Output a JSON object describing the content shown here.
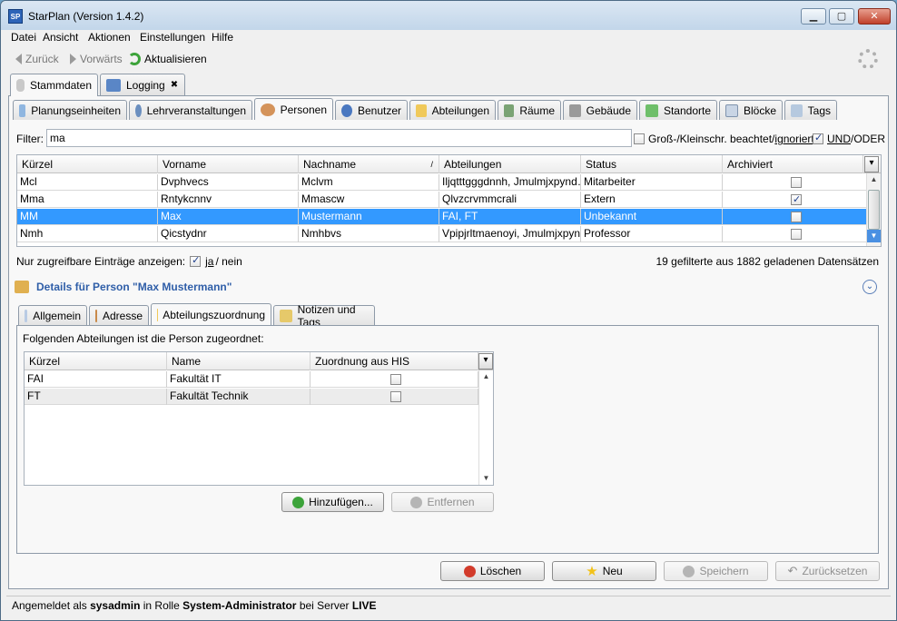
{
  "window": {
    "title": "StarPlan (Version 1.4.2)",
    "app_icon": "SP"
  },
  "menu": [
    "Datei",
    "Ansicht",
    "Aktionen",
    "Einstellungen",
    "Hilfe"
  ],
  "toolbar": {
    "back": "Zurück",
    "forward": "Vorwärts",
    "refresh": "Aktualisieren"
  },
  "main_tabs": [
    {
      "label": "Stammdaten",
      "icon": "database-icon"
    },
    {
      "label": "Logging",
      "icon": "book-icon"
    }
  ],
  "sub_tabs": [
    {
      "label": "Planungseinheiten",
      "icon": "table-icon"
    },
    {
      "label": "Lehrveranstaltungen",
      "icon": "teacher-icon"
    },
    {
      "label": "Personen",
      "icon": "person-icon"
    },
    {
      "label": "Benutzer",
      "icon": "user-icon"
    },
    {
      "label": "Abteilungen",
      "icon": "folder-icon"
    },
    {
      "label": "Räume",
      "icon": "room-icon"
    },
    {
      "label": "Gebäude",
      "icon": "building-icon"
    },
    {
      "label": "Standorte",
      "icon": "location-icon"
    },
    {
      "label": "Blöcke",
      "icon": "calendar-icon"
    },
    {
      "label": "Tags",
      "icon": "tag-icon"
    }
  ],
  "filter": {
    "label": "Filter:",
    "value": "ma",
    "case_label": "Groß-/Kleinschr. beachtet/",
    "case_label_link": "ignoriert",
    "case_checked": false,
    "und_oder_label_a": "UND",
    "und_oder_label_b": "/ODER",
    "und_oder_checked": true
  },
  "persons_table": {
    "columns": [
      "Kürzel",
      "Vorname",
      "Nachname",
      "Abteilungen",
      "Status",
      "Archiviert"
    ],
    "rows": [
      {
        "kuerzel": "Mcl",
        "vorname": "Dvphvecs",
        "nachname": "Mclvm",
        "abteilungen": "Iljqtttgggdnnh, Jmulmjxpynd…",
        "status": "Mitarbeiter",
        "archiviert": false
      },
      {
        "kuerzel": "Mma",
        "vorname": "Rntykcnnv",
        "nachname": "Mmascw",
        "abteilungen": "Qlvzcrvmmcrali",
        "status": "Extern",
        "archiviert": true
      },
      {
        "kuerzel": "MM",
        "vorname": "Max",
        "nachname": "Mustermann",
        "abteilungen": "FAI, FT",
        "status": "Unbekannt",
        "archiviert": false
      },
      {
        "kuerzel": "Nmh",
        "vorname": "Qicstydnr",
        "nachname": "Nmhbvs",
        "abteilungen": "Vpipjrltmaenoyi, Jmulmjxpyn…",
        "status": "Professor",
        "archiviert": false
      }
    ],
    "selected_row": 2,
    "sort_indicator": "/"
  },
  "accessible_only": {
    "label": "Nur zugreifbare Einträge anzeigen:",
    "yes": "ja",
    "no": "/ nein",
    "checked": true
  },
  "count_text": "19 gefilterte aus 1882 geladenen Datensätzen",
  "details": {
    "title": "Details für Person \"Max Mustermann\""
  },
  "detail_tabs": [
    {
      "label": "Allgemein",
      "icon": "form-icon"
    },
    {
      "label": "Adresse",
      "icon": "house-icon"
    },
    {
      "label": "Abteilungszuordnung",
      "icon": "folder-icon"
    },
    {
      "label": "Notizen und Tags",
      "icon": "note-icon"
    }
  ],
  "assignment": {
    "intro": "Folgenden Abteilungen ist die Person zugeordnet:",
    "columns": [
      "Kürzel",
      "Name",
      "Zuordnung aus HIS"
    ],
    "rows": [
      {
        "kuerzel": "FAI",
        "name": "Fakultät IT",
        "his": false
      },
      {
        "kuerzel": "FT",
        "name": "Fakultät Technik",
        "his": false
      }
    ],
    "add_button": "Hinzufügen...",
    "remove_button": "Entfernen"
  },
  "actions": {
    "delete": "Löschen",
    "new": "Neu",
    "save": "Speichern",
    "reset": "Zurücksetzen"
  },
  "status": {
    "prefix": "Angemeldet als ",
    "user": "sysadmin",
    "mid": " in Rolle ",
    "role": "System-Administrator",
    "mid2": " bei Server ",
    "server": "LIVE"
  },
  "colors": {
    "selection": "#3399ff",
    "accent": "#2f5ea8",
    "add": "#3ca33a",
    "delete": "#d23b2b",
    "new": "#f2c21a"
  }
}
